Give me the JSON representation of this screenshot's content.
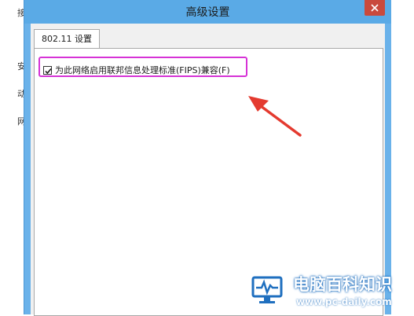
{
  "dialog": {
    "title": "高级设置",
    "tabs": [
      {
        "label": "802.11 设置"
      }
    ],
    "options": [
      {
        "label": "为此网络启用联邦信息处理标准(FIPS)兼容(F)",
        "checked": true
      }
    ]
  },
  "background_window": {
    "chars": [
      "接",
      "安",
      "动",
      "网"
    ]
  },
  "watermark": {
    "title": "电脑百科知识",
    "url": "www.pc-daily.com"
  },
  "colors": {
    "titlebar": "#5aaae6",
    "highlight_box": "#d633d6",
    "arrow": "#e43a2f",
    "close_button": "#c94a3d"
  }
}
